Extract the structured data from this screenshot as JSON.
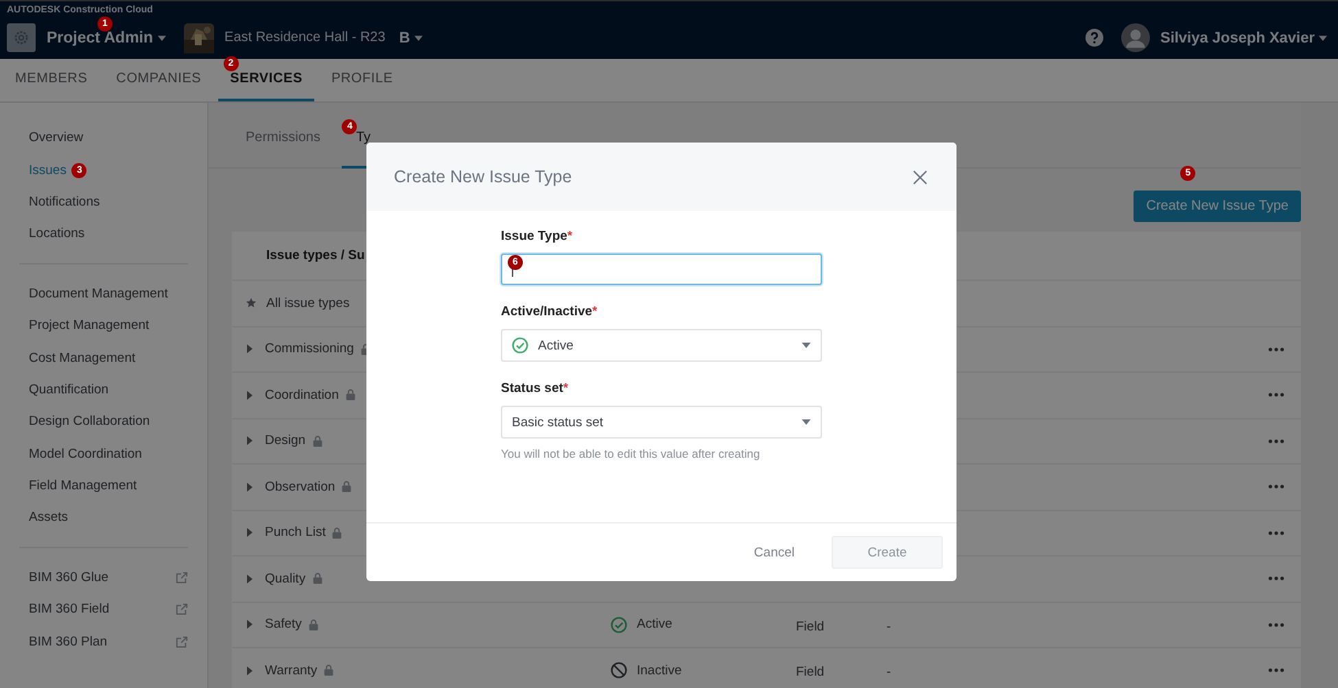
{
  "app": {
    "brand": "AUTODESK Construction Cloud",
    "module": "Project Admin",
    "module_marker": "1",
    "project": "East Residence Hall - R23",
    "project_badge": "B",
    "user": "Silviya Joseph Xavier"
  },
  "main_tabs": [
    {
      "label": "MEMBERS",
      "selected": false
    },
    {
      "label": "COMPANIES",
      "selected": false
    },
    {
      "label": "SERVICES",
      "selected": true,
      "marker": "2"
    },
    {
      "label": "PROFILE",
      "selected": false
    }
  ],
  "sidebar": {
    "groups": [
      [
        {
          "label": "Overview",
          "selected": false
        },
        {
          "label": "Issues",
          "selected": true,
          "marker": "3"
        },
        {
          "label": "Notifications",
          "selected": false
        },
        {
          "label": "Locations",
          "selected": false
        }
      ],
      [
        {
          "label": "Document Management",
          "selected": false
        },
        {
          "label": "Project Management",
          "selected": false
        },
        {
          "label": "Cost Management",
          "selected": false
        },
        {
          "label": "Quantification",
          "selected": false
        },
        {
          "label": "Design Collaboration",
          "selected": false
        },
        {
          "label": "Model Coordination",
          "selected": false
        },
        {
          "label": "Field Management",
          "selected": false
        },
        {
          "label": "Assets",
          "selected": false
        }
      ],
      [
        {
          "label": "BIM 360 Glue",
          "selected": false,
          "external": true
        },
        {
          "label": "BIM 360 Field",
          "selected": false,
          "external": true
        },
        {
          "label": "BIM 360 Plan",
          "selected": false,
          "external": true
        }
      ]
    ]
  },
  "sub_tabs": [
    {
      "label": "Permissions",
      "selected": false
    },
    {
      "label": "Ty",
      "selected": true,
      "marker": "4"
    }
  ],
  "create_button": {
    "label": "Create New Issue Type",
    "marker": "5"
  },
  "table": {
    "header": "Issue types / Su",
    "all_row": "All issue types",
    "rows": [
      {
        "name": "Commissioning",
        "locked": true
      },
      {
        "name": "Coordination",
        "locked": true
      },
      {
        "name": "Design",
        "locked": true
      },
      {
        "name": "Observation",
        "locked": true
      },
      {
        "name": "Punch List",
        "locked": true
      },
      {
        "name": "Quality",
        "locked": true
      },
      {
        "name": "Safety",
        "locked": true,
        "status": "Active",
        "active": true,
        "category": "Field",
        "extra": "-"
      },
      {
        "name": "Warranty",
        "locked": true,
        "status": "Inactive",
        "active": false,
        "category": "Field",
        "extra": "-"
      }
    ]
  },
  "dialog": {
    "title": "Create New Issue Type",
    "fields": [
      {
        "kind": "text",
        "label": "Issue Type",
        "required_mark": "*",
        "focused": true,
        "marker": "6"
      },
      {
        "kind": "select",
        "label": "Active/Inactive",
        "required_mark": "*",
        "value": "Active",
        "active": true
      },
      {
        "kind": "select",
        "label": "Status set",
        "required_mark": "*",
        "value": "Basic status set",
        "hint": "You will not be able to edit this value after creating"
      }
    ],
    "buttons": [
      {
        "label": "Cancel",
        "kind": "secondary"
      },
      {
        "label": "Create",
        "kind": "primary",
        "disabled": true
      }
    ]
  }
}
